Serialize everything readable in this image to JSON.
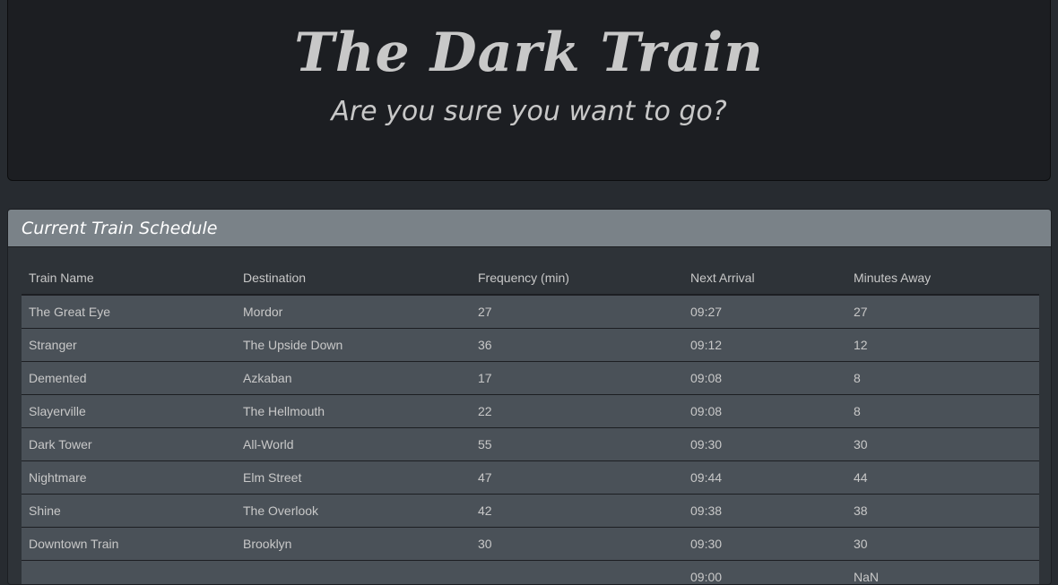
{
  "header": {
    "title": "The Dark Train",
    "subtitle": "Are you sure you want to go?"
  },
  "panel": {
    "title": "Current Train Schedule"
  },
  "table": {
    "columns": [
      "Train Name",
      "Destination",
      "Frequency (min)",
      "Next Arrival",
      "Minutes Away"
    ],
    "rows": [
      [
        "The Great Eye",
        "Mordor",
        "27",
        "09:27",
        "27"
      ],
      [
        "Stranger",
        "The Upside Down",
        "36",
        "09:12",
        "12"
      ],
      [
        "Demented",
        "Azkaban",
        "17",
        "09:08",
        "8"
      ],
      [
        "Slayerville",
        "The Hellmouth",
        "22",
        "09:08",
        "8"
      ],
      [
        "Dark Tower",
        "All-World",
        "55",
        "09:30",
        "30"
      ],
      [
        "Nightmare",
        "Elm Street",
        "47",
        "09:44",
        "44"
      ],
      [
        "Shine",
        "The Overlook",
        "42",
        "09:38",
        "38"
      ],
      [
        "Downtown Train",
        "Brooklyn",
        "30",
        "09:30",
        "30"
      ],
      [
        "",
        "",
        "",
        "09:00",
        "NaN"
      ]
    ]
  },
  "colors": {
    "background": "#272b30",
    "jumbotron": "#1c1e22",
    "panel_heading": "#7a8288",
    "row": "#4a5158",
    "text": "#c8c8c8"
  }
}
